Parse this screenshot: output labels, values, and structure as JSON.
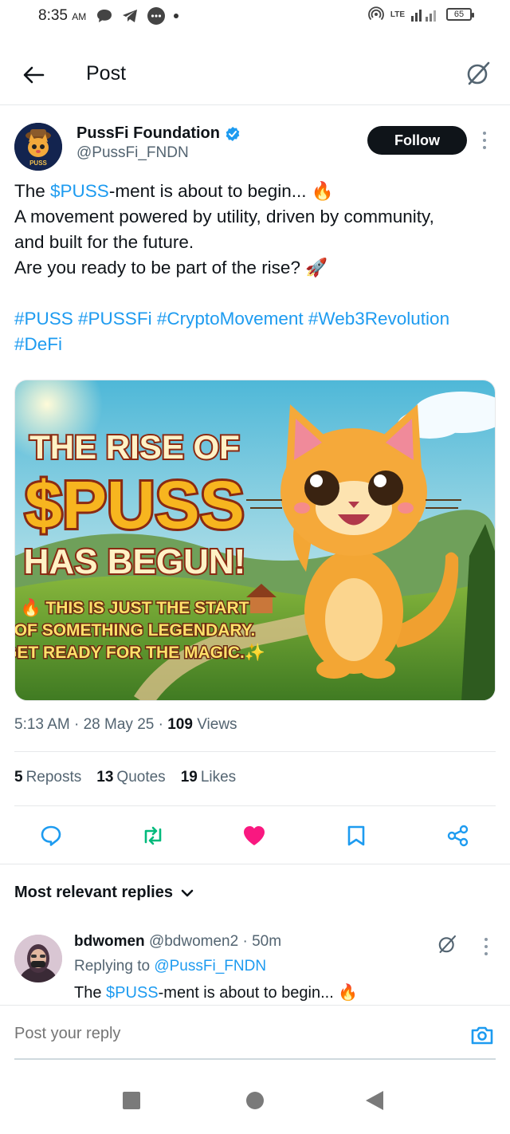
{
  "status_bar": {
    "time": "8:35",
    "ampm": "AM",
    "battery": "65",
    "network": "LTE"
  },
  "header": {
    "title": "Post"
  },
  "author": {
    "name": "PussFi Foundation",
    "handle": "@PussFi_FNDN",
    "follow_label": "Follow",
    "avatar_text": "PUSS"
  },
  "tweet": {
    "line1_pre": "The ",
    "line1_tag": "$PUSS",
    "line1_post": "-ment is about to begin... 🔥",
    "line2": "A movement powered by utility, driven by community,",
    "line3": "and built for the future.",
    "line4": "Are you ready to be part of the rise? 🚀",
    "hashtags_line1": "#PUSS #PUSSFi #CryptoMovement #Web3Revolution",
    "hashtags_line2": "#DeFi"
  },
  "media": {
    "headline1": "THE RISE OF",
    "headline2": "$PUSS",
    "headline3": "HAS BEGUN!",
    "sub1": "🔥 THIS IS JUST THE START",
    "sub2": "OF SOMETHING LEGENDARY.",
    "sub3": "GET READY FOR THE MAGIC.✨"
  },
  "meta": {
    "time": "5:13 AM",
    "date": "28 May 25",
    "views_count": "109",
    "views_label": "Views"
  },
  "stats": {
    "reposts_count": "5",
    "reposts_label": "Reposts",
    "quotes_count": "13",
    "quotes_label": "Quotes",
    "likes_count": "19",
    "likes_label": "Likes"
  },
  "colors": {
    "accent": "#1d9bf0",
    "like": "#f91880",
    "repost": "#00ba7c"
  },
  "replies": {
    "sort_label": "Most relevant replies",
    "items": [
      {
        "name": "bdwomen",
        "handle": "@bdwomen2",
        "time": "50m",
        "replying_label": "Replying to",
        "replying_handle": "@PussFi_FNDN",
        "text_pre": "The ",
        "text_tag": "$PUSS",
        "text_post": "-ment is about to begin... 🔥"
      }
    ]
  },
  "composer": {
    "placeholder": "Post your reply"
  }
}
